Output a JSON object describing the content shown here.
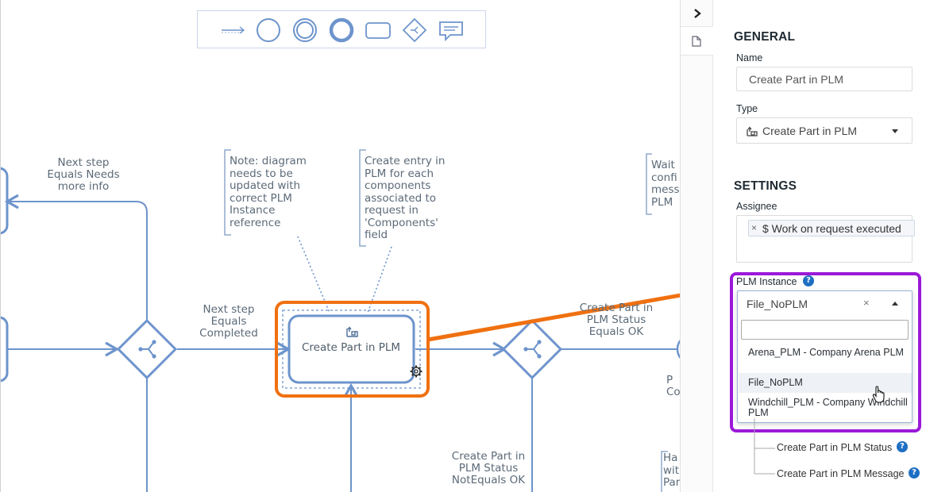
{
  "palette": {
    "tools": [
      "sequence-flow-icon",
      "start-event-icon",
      "intermediate-event-icon",
      "end-event-icon",
      "task-icon",
      "gateway-icon",
      "annotation-icon"
    ]
  },
  "diagram": {
    "label_needs_info": "Next step\nEquals Needs\nmore info",
    "label_completed": "Next step\nEquals\nCompleted",
    "note_plm_instance": "Note: diagram\nneeds to be\nupdated with\ncorrect PLM\nInstance\nreference",
    "note_create_entry": "Create entry in\nPLM for each\ncomponents\nassociated to\nrequest in\n'Components'\nfield",
    "note_wait": "Wait\nconfi\nmess\nPLM",
    "task_label": "Create Part in PLM",
    "label_status_ok": "Create Part in\nPLM Status\nEquals OK",
    "label_status_notok": "Create Part in\nPLM Status\nNotEquals OK",
    "label_p": "P\nCo",
    "note_ha": "Ha\nwit\nPar"
  },
  "panel": {
    "general_title": "GENERAL",
    "name_label": "Name",
    "name_value": "Create Part in PLM",
    "type_label": "Type",
    "type_value": "Create Part in PLM",
    "settings_title": "SETTINGS",
    "assignee_label": "Assignee",
    "assignee_tag": "$ Work on request executed",
    "assignee_tag_remove": "×",
    "plm_instance_label": "PLM Instance",
    "plm_instance_value": "File_NoPLM",
    "plm_clear": "×",
    "plm_search_value": "",
    "plm_options": [
      "Arena_PLM - Company Arena PLM",
      "File_NoPLM",
      "Windchill_PLM - Company Windchill PLM"
    ],
    "outputs": [
      "Create Part in PLM Status",
      "Create Part in PLM Message"
    ],
    "help_glyph": "?"
  },
  "colors": {
    "flow": "#6d94cc",
    "highlight_orange": "#f07010",
    "highlight_purple": "#9b19d8",
    "accent_blue": "#1e6fc3"
  }
}
